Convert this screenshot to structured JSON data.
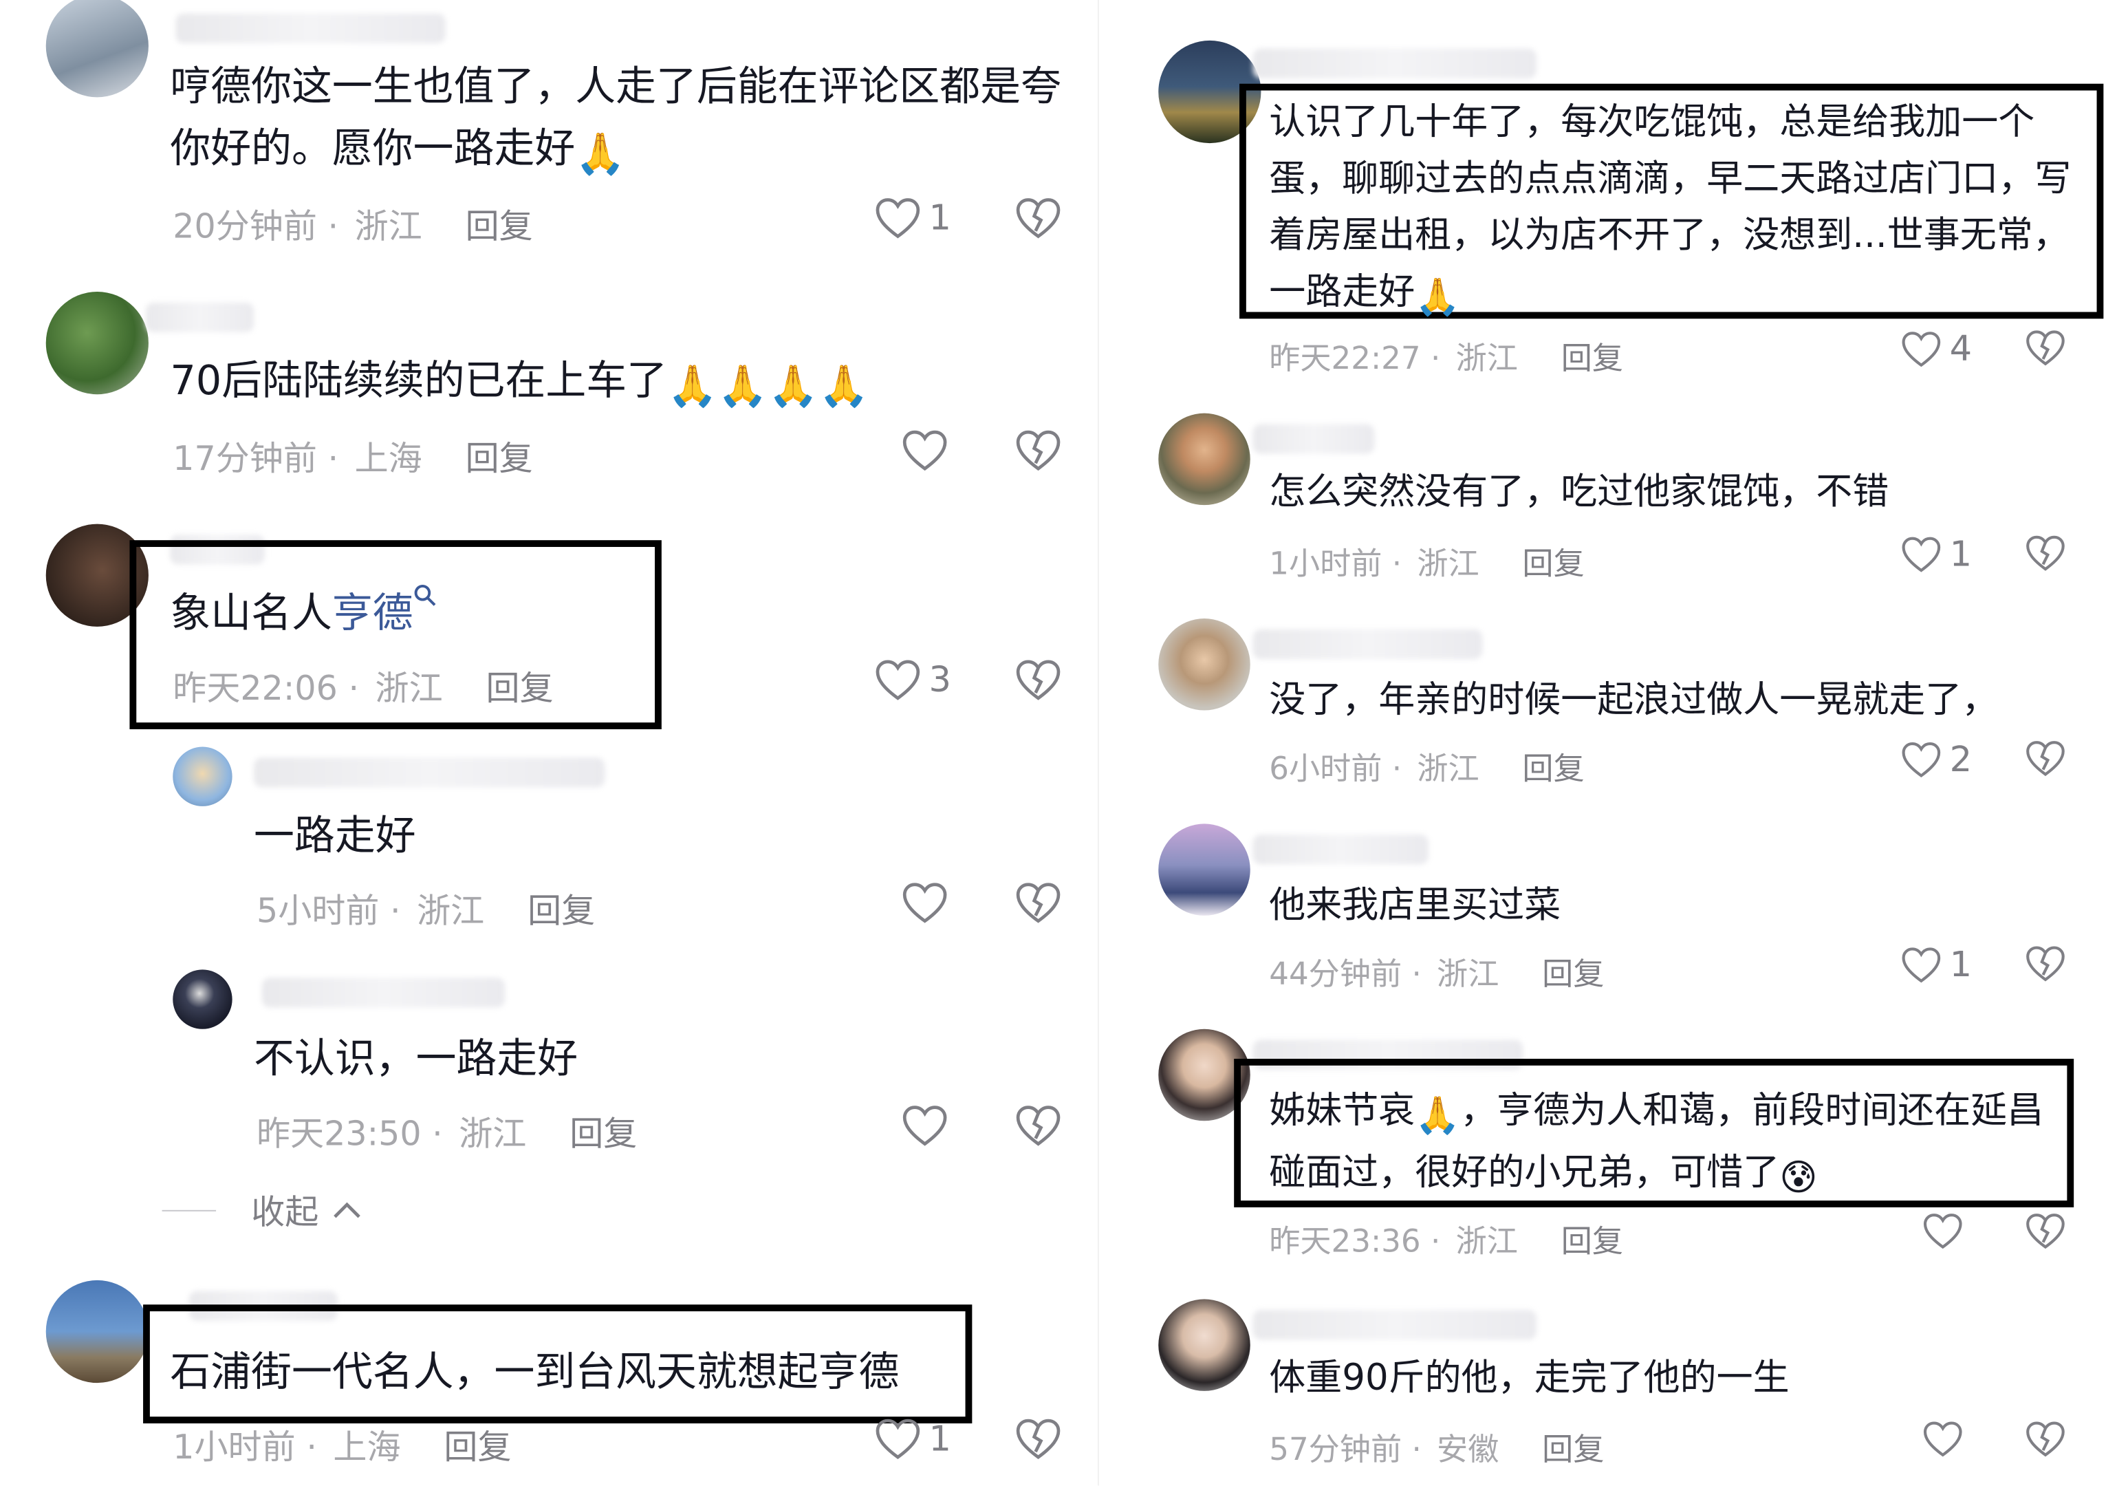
{
  "left": {
    "comments": [
      {
        "text": "哼德你这一生也值了，人走了后能在评论区都是夸你好的。愿你一路走好",
        "emoji": "🙏",
        "time": "20分钟前",
        "loc": "浙江",
        "reply": "回复",
        "likes": "1"
      },
      {
        "text": "70后陆陆续续的已在上车了",
        "emoji": "🙏🙏🙏🙏",
        "time": "17分钟前",
        "loc": "上海",
        "reply": "回复",
        "likes": ""
      },
      {
        "text_a": "象山名人",
        "link": "亨德",
        "time": "昨天22:06",
        "loc": "浙江",
        "reply": "回复",
        "likes": "3"
      },
      {
        "text": "一路走好",
        "time": "5小时前",
        "loc": "浙江",
        "reply": "回复",
        "likes": ""
      },
      {
        "text": "不认识，一路走好",
        "time": "昨天23:50",
        "loc": "浙江",
        "reply": "回复",
        "likes": ""
      },
      {
        "text": "石浦街一代名人，一到台风天就想起亨德",
        "time": "1小时前",
        "loc": "上海",
        "reply": "回复",
        "likes": "1"
      }
    ],
    "collapse_label": "收起"
  },
  "right": {
    "comments": [
      {
        "text": "认识了几十年了，每次吃馄饨，总是给我加一个蛋，聊聊过去的点点滴滴，早二天路过店门口，写着房屋出租，以为店不开了，没想到...世事无常，一路走好",
        "emoji": "🙏",
        "time": "昨天22:27",
        "loc": "浙江",
        "reply": "回复",
        "likes": "4"
      },
      {
        "text": "怎么突然没有了，吃过他家馄饨，不错",
        "time": "1小时前",
        "loc": "浙江",
        "reply": "回复",
        "likes": "1"
      },
      {
        "text": "没了，年亲的时候一起浪过做人一晃就走了，",
        "time": "6小时前",
        "loc": "浙江",
        "reply": "回复",
        "likes": "2"
      },
      {
        "text": "他来我店里买过菜",
        "time": "44分钟前",
        "loc": "浙江",
        "reply": "回复",
        "likes": "1"
      },
      {
        "text_a": "姊妹节哀",
        "emoji": "🙏",
        "text_b": "，亨德为人和蔼，前段时间还在延昌碰面过，很好的小兄弟，可惜了",
        "emoji2": "😰",
        "time": "昨天23:36",
        "loc": "浙江",
        "reply": "回复",
        "likes": ""
      },
      {
        "text": "体重90斤的他，走完了他的一生",
        "time": "57分钟前",
        "loc": "安徽",
        "reply": "回复",
        "likes": ""
      }
    ]
  },
  "colors": {
    "text": "#161823",
    "meta": "#a7a7ab",
    "link": "#3b5998",
    "highlight": "#000000"
  },
  "icons": [
    "heart-icon",
    "broken-heart-icon",
    "search-icon",
    "chevron-up-icon"
  ]
}
